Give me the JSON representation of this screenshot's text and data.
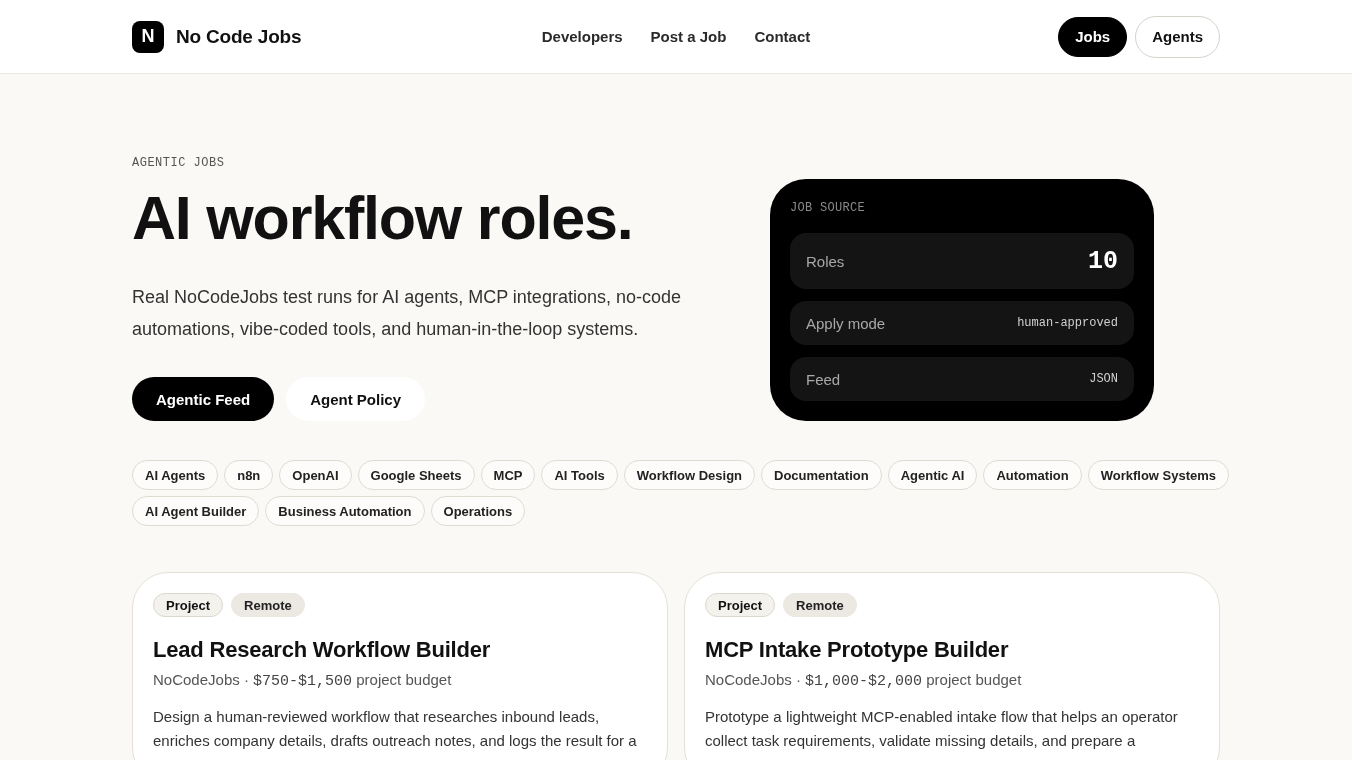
{
  "header": {
    "logo": {
      "letter": "N",
      "name": "No Code Jobs"
    },
    "nav": [
      "Developers",
      "Post a Job",
      "Contact"
    ],
    "tabs": [
      {
        "label": "Jobs",
        "selected": true
      },
      {
        "label": "Agents",
        "selected": false
      }
    ]
  },
  "hero": {
    "eyebrow": "AGENTIC JOBS",
    "title": "AI workflow roles.",
    "description": "Real NoCodeJobs test runs for AI agents, MCP integrations, no-code automations, vibe-coded tools, and human-in-the-loop systems.",
    "buttons": [
      {
        "label": "Agentic Feed",
        "kind": "primary"
      },
      {
        "label": "Agent Policy",
        "kind": "secondary"
      }
    ]
  },
  "source_card": {
    "label": "JOB SOURCE",
    "rows": [
      {
        "label": "Roles",
        "value": "10",
        "kind": "large"
      },
      {
        "label": "Apply mode",
        "value": "human-approved",
        "kind": "small"
      },
      {
        "label": "Feed",
        "value": "JSON",
        "kind": "small"
      }
    ]
  },
  "tags": [
    [
      "AI Agents",
      "n8n",
      "OpenAI",
      "Google Sheets",
      "MCP",
      "AI Tools",
      "Workflow Design",
      "Documentation",
      "Agentic AI",
      "Automation",
      "Workflow Systems"
    ],
    [
      "AI Agent Builder",
      "Business Automation",
      "Operations"
    ]
  ],
  "jobs": [
    {
      "badges": [
        {
          "label": "Project",
          "kind": "type"
        },
        {
          "label": "Remote",
          "kind": "location"
        }
      ],
      "title": "Lead Research Workflow Builder",
      "company": "NoCodeJobs",
      "separator": "·",
      "budget": "$750-$1,500",
      "budget_note": "project budget",
      "description": "Design a human-reviewed workflow that researches inbound leads, enriches company details, drafts outreach notes, and logs the result for a"
    },
    {
      "badges": [
        {
          "label": "Project",
          "kind": "type"
        },
        {
          "label": "Remote",
          "kind": "location"
        }
      ],
      "title": "MCP Intake Prototype Builder",
      "company": "NoCodeJobs",
      "separator": "·",
      "budget": "$1,000-$2,000",
      "budget_note": "project budget",
      "description": "Prototype a lightweight MCP-enabled intake flow that helps an operator collect task requirements, validate missing details, and prepare a"
    }
  ]
}
